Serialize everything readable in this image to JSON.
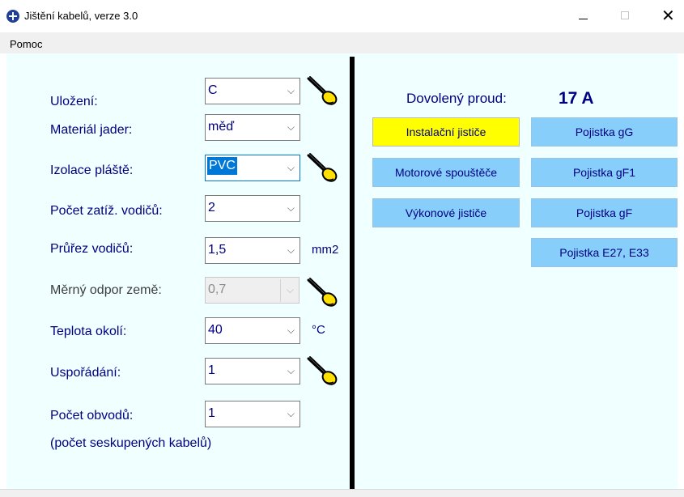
{
  "window": {
    "title": "Jištění kabelů, verze 3.0"
  },
  "menu": {
    "items": [
      "Pomoc"
    ]
  },
  "form": {
    "rows": [
      {
        "label": "Uložení:",
        "value": "C"
      },
      {
        "label": "Materiál jader:",
        "value": "měď"
      },
      {
        "label": "Izolace pláště:",
        "value": "PVC"
      },
      {
        "label": "Počet zatíž. vodičů:",
        "value": "2"
      },
      {
        "label": "Průřez vodičů:",
        "value": "1,5",
        "unit": "mm2"
      },
      {
        "label": "Měrný odpor země:",
        "value": "0,7"
      },
      {
        "label": "Teplota okolí:",
        "value": "40",
        "unit": "°C"
      },
      {
        "label": "Uspořádání:",
        "value": "1"
      },
      {
        "label": "Počet obvodů:",
        "value": "1",
        "note": "(počet seskupených kabelů)"
      }
    ]
  },
  "result": {
    "label": "Dovolený proud:",
    "value": "17 A"
  },
  "buttons": {
    "instalacni": "Instalační jističe",
    "motorove": "Motorové spouštěče",
    "vykonove": "Výkonové jističe",
    "gg": "Pojistka gG",
    "gf1": "Pojistka gF1",
    "gf": "Pojistka gF",
    "e27": "Pojistka E27, E33"
  },
  "colors": {
    "form_background": "#f0ffff",
    "label_text": "#000080",
    "button_background": "#87cefa",
    "active_button_background": "#ffff00"
  },
  "icons": [
    "app-plus-icon",
    "pointing-hand-icon"
  ]
}
